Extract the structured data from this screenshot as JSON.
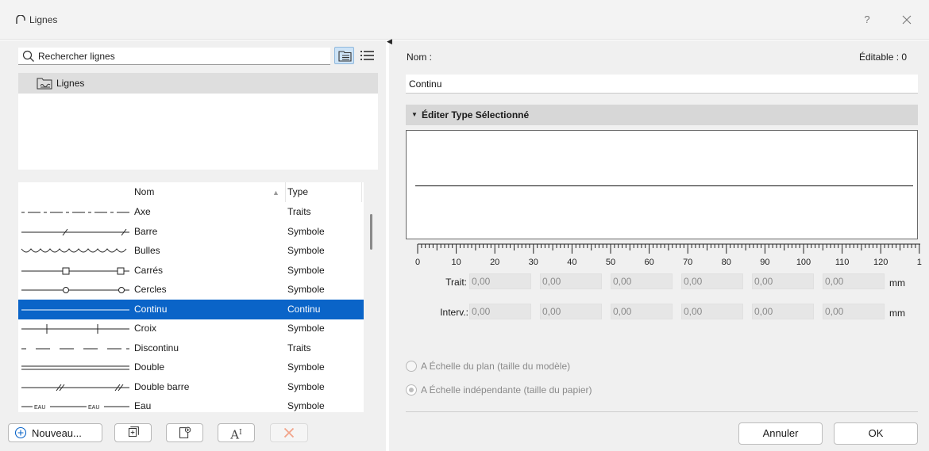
{
  "window": {
    "title": "Lignes",
    "help_label": "?"
  },
  "search": {
    "placeholder": "Rechercher lignes"
  },
  "folder_tree": {
    "items": [
      {
        "label": "Lignes"
      }
    ]
  },
  "lines_table": {
    "columns": {
      "name": "Nom",
      "type": "Type"
    },
    "sort_column": "Nom",
    "sort_direction": "ascending",
    "rows": [
      {
        "name": "Axe",
        "type": "Traits",
        "preview": "dash-dot"
      },
      {
        "name": "Barre",
        "type": "Symbole",
        "preview": "slash"
      },
      {
        "name": "Bulles",
        "type": "Symbole",
        "preview": "bubbles"
      },
      {
        "name": "Carrés",
        "type": "Symbole",
        "preview": "squares"
      },
      {
        "name": "Cercles",
        "type": "Symbole",
        "preview": "circles"
      },
      {
        "name": "Continu",
        "type": "Continu",
        "preview": "solid",
        "selected": true
      },
      {
        "name": "Croix",
        "type": "Symbole",
        "preview": "crosses"
      },
      {
        "name": "Discontinu",
        "type": "Traits",
        "preview": "dashed"
      },
      {
        "name": "Double",
        "type": "Symbole",
        "preview": "double"
      },
      {
        "name": "Double barre",
        "type": "Symbole",
        "preview": "double-slash"
      },
      {
        "name": "Eau",
        "type": "Symbole",
        "preview": "water"
      }
    ]
  },
  "toolbar": {
    "new_label": "Nouveau...",
    "rename_glyph": "A",
    "rename_superscript": "I"
  },
  "details": {
    "name_label": "Nom :",
    "editable_label": "Éditable : 0",
    "name_value": "Continu",
    "section_title": "Éditer Type Sélectionné"
  },
  "ruler": {
    "ticks": [
      "0",
      "10",
      "20",
      "30",
      "40",
      "50",
      "60",
      "70",
      "80",
      "90",
      "100",
      "110",
      "120",
      "1"
    ]
  },
  "dash_pattern": {
    "trait_label": "Trait:",
    "interval_label": "Interv.:",
    "unit": "mm",
    "trait_values": [
      "0,00",
      "0,00",
      "0,00",
      "0,00",
      "0,00",
      "0,00"
    ],
    "interval_values": [
      "0,00",
      "0,00",
      "0,00",
      "0,00",
      "0,00",
      "0,00"
    ]
  },
  "scale_options": {
    "options": [
      {
        "label": "A Échelle du plan (taille du modèle)",
        "checked": false
      },
      {
        "label": "A Échelle indépendante (taille du papier)",
        "checked": true
      }
    ]
  },
  "footer": {
    "cancel_label": "Annuler",
    "ok_label": "OK"
  }
}
